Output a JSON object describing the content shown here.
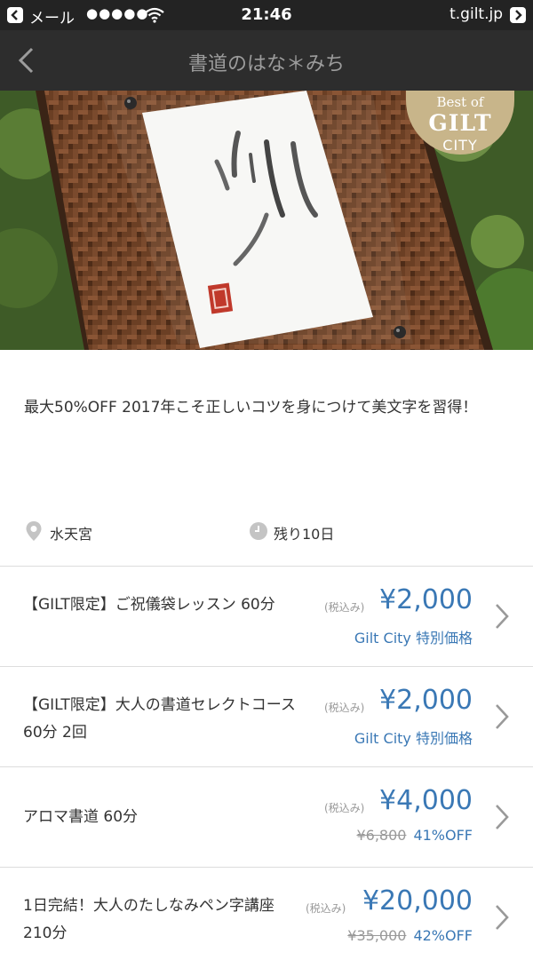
{
  "status_bar": {
    "back_app": "メール",
    "signal": "●●●●●",
    "time": "21:46",
    "url": "t.gilt.jp"
  },
  "nav": {
    "title": "書道のはな＊みち"
  },
  "hero": {
    "badge_top": "Best of",
    "badge_brand": "GILT",
    "badge_bottom": "CITY"
  },
  "description": "最大50%OFF 2017年こそ正しいコツを身につけて美文字を習得！",
  "meta": {
    "location": "水天宮",
    "remaining": "残り10日"
  },
  "deals": [
    {
      "title": "【GILT限定】ご祝儀袋レッスン 60分",
      "tax": "(税込み)",
      "price": "¥2,000",
      "note": "Gilt City 特別価格"
    },
    {
      "title": "【GILT限定】大人の書道セレクトコース 60分 2回",
      "tax": "(税込み)",
      "price": "¥2,000",
      "note": "Gilt City 特別価格"
    },
    {
      "title": "アロマ書道 60分",
      "tax": "(税込み)",
      "price": "¥4,000",
      "original_price": "¥6,800",
      "discount": "41%OFF"
    },
    {
      "title": "1日完結！大人のたしなみペン字講座 210分",
      "tax": "(税込み)",
      "price": "¥20,000",
      "original_price": "¥35,000",
      "discount": "42%OFF"
    }
  ],
  "colors": {
    "price_blue": "#3a78b5",
    "nav_bg": "#2d2d2d",
    "status_bg": "#232323"
  }
}
